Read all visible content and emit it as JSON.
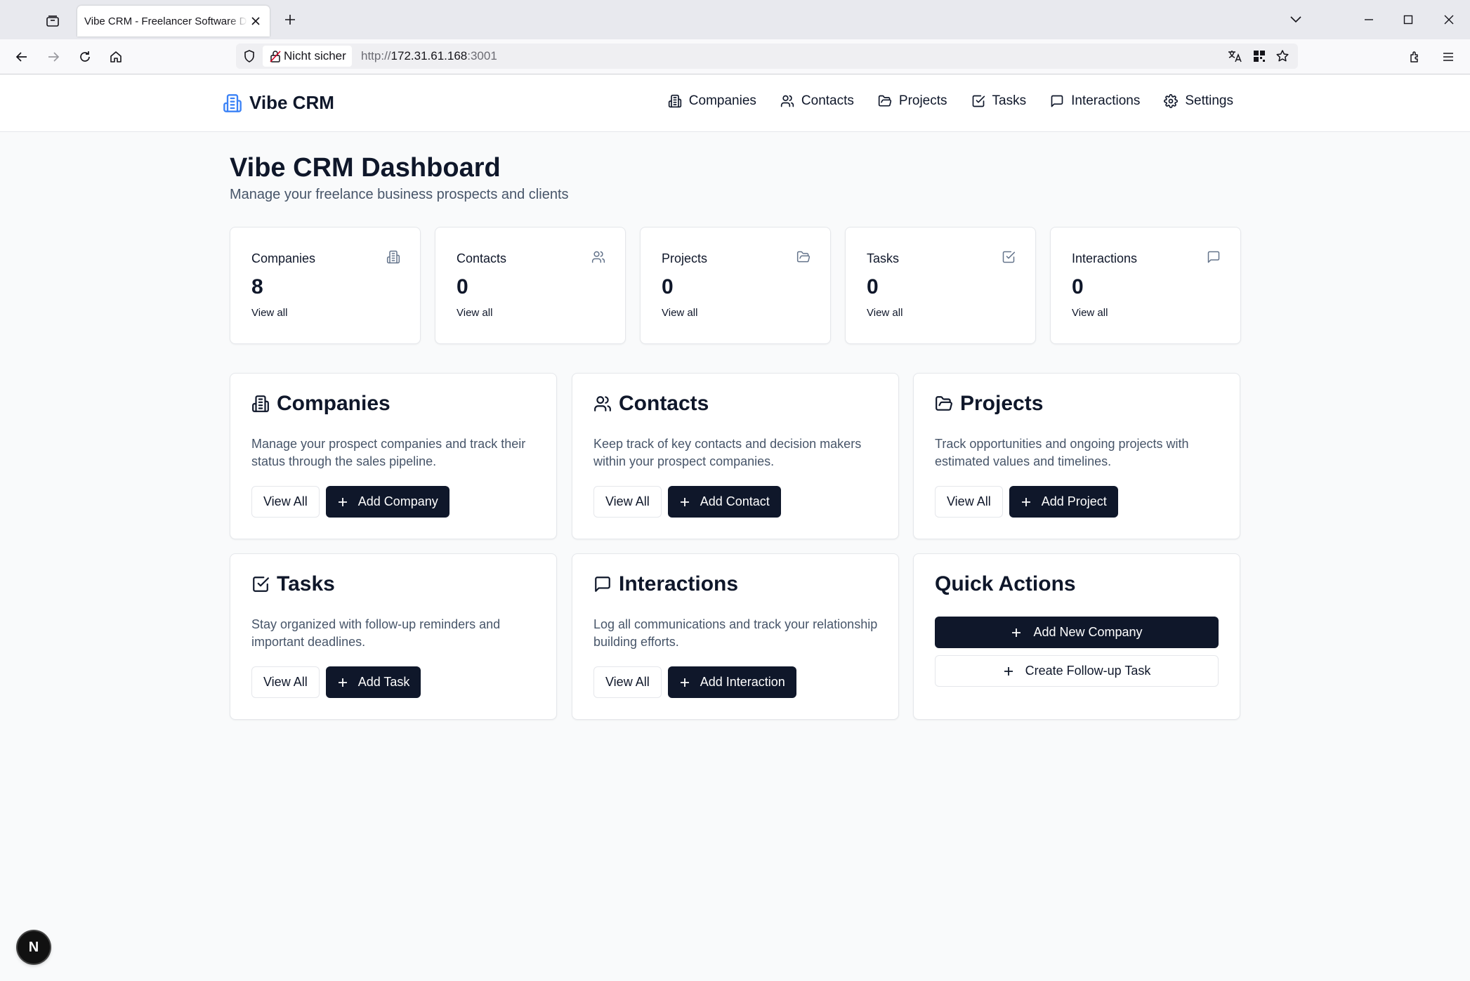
{
  "browser": {
    "tab_title": "Vibe CRM - Freelancer Software Developer CRM",
    "security_label": "Nicht sicher",
    "url_scheme": "http://",
    "url_host": "172.31.61.168",
    "url_port": ":3001"
  },
  "header": {
    "brand": "Vibe CRM",
    "nav": [
      {
        "label": "Companies",
        "icon": "building-icon"
      },
      {
        "label": "Contacts",
        "icon": "users-icon"
      },
      {
        "label": "Projects",
        "icon": "folder-icon"
      },
      {
        "label": "Tasks",
        "icon": "check-square-icon"
      },
      {
        "label": "Interactions",
        "icon": "message-square-icon"
      },
      {
        "label": "Settings",
        "icon": "gear-icon"
      }
    ]
  },
  "page": {
    "title": "Vibe CRM Dashboard",
    "subtitle": "Manage your freelance business prospects and clients"
  },
  "stats": [
    {
      "label": "Companies",
      "value": "8",
      "link": "View all",
      "icon": "building-icon"
    },
    {
      "label": "Contacts",
      "value": "0",
      "link": "View all",
      "icon": "users-icon"
    },
    {
      "label": "Projects",
      "value": "0",
      "link": "View all",
      "icon": "folder-icon"
    },
    {
      "label": "Tasks",
      "value": "0",
      "link": "View all",
      "icon": "check-square-icon"
    },
    {
      "label": "Interactions",
      "value": "0",
      "link": "View all",
      "icon": "message-square-icon"
    }
  ],
  "sections": [
    {
      "title": "Companies",
      "description": "Manage your prospect companies and track their status through the sales pipeline.",
      "view_label": "View All",
      "add_label": "Add Company",
      "icon": "building-icon"
    },
    {
      "title": "Contacts",
      "description": "Keep track of key contacts and decision makers within your prospect companies.",
      "view_label": "View All",
      "add_label": "Add Contact",
      "icon": "users-icon"
    },
    {
      "title": "Projects",
      "description": "Track opportunities and ongoing projects with estimated values and timelines.",
      "view_label": "View All",
      "add_label": "Add Project",
      "icon": "folder-icon"
    },
    {
      "title": "Tasks",
      "description": "Stay organized with follow-up reminders and important deadlines.",
      "view_label": "View All",
      "add_label": "Add Task",
      "icon": "check-square-icon"
    },
    {
      "title": "Interactions",
      "description": "Log all communications and track your relationship building efforts.",
      "view_label": "View All",
      "add_label": "Add Interaction",
      "icon": "message-square-icon"
    }
  ],
  "quick_actions": {
    "title": "Quick Actions",
    "primary": "Add New Company",
    "secondary": "Create Follow-up Task"
  },
  "dev_badge": "N",
  "colors": {
    "primary": "#0f172a",
    "brand_icon": "#3b82f6",
    "muted_text": "#475569",
    "page_bg": "#f9fafb"
  }
}
